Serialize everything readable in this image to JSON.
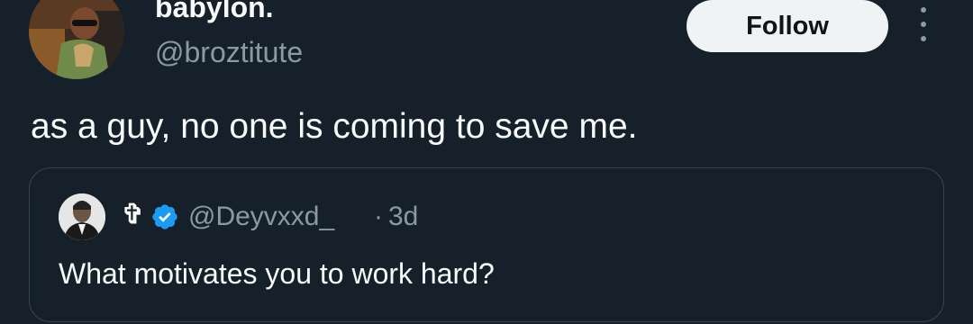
{
  "tweet": {
    "author": {
      "display_name": "babylon.",
      "handle": "@broztitute",
      "avatar": "profile-photo-man-in-sunglasses"
    },
    "follow_label": "Follow",
    "more_icon": "more-vertical-icon",
    "text": "as a guy, no one is coming to save me."
  },
  "quoted_tweet": {
    "author": {
      "display_name": "✞",
      "handle": "@Deyvxxd_",
      "avatar": "profile-photo-man-in-suit",
      "verified": true
    },
    "separator": "·",
    "time": "3d",
    "text": "What motivates you to work hard?"
  },
  "colors": {
    "background": "#15202b",
    "primary_text": "#f7f9f9",
    "secondary_text": "#8b98a5",
    "border": "#38444d",
    "verified_blue": "#1d9bf0",
    "follow_bg": "#eff3f4",
    "follow_text": "#0f1419"
  }
}
